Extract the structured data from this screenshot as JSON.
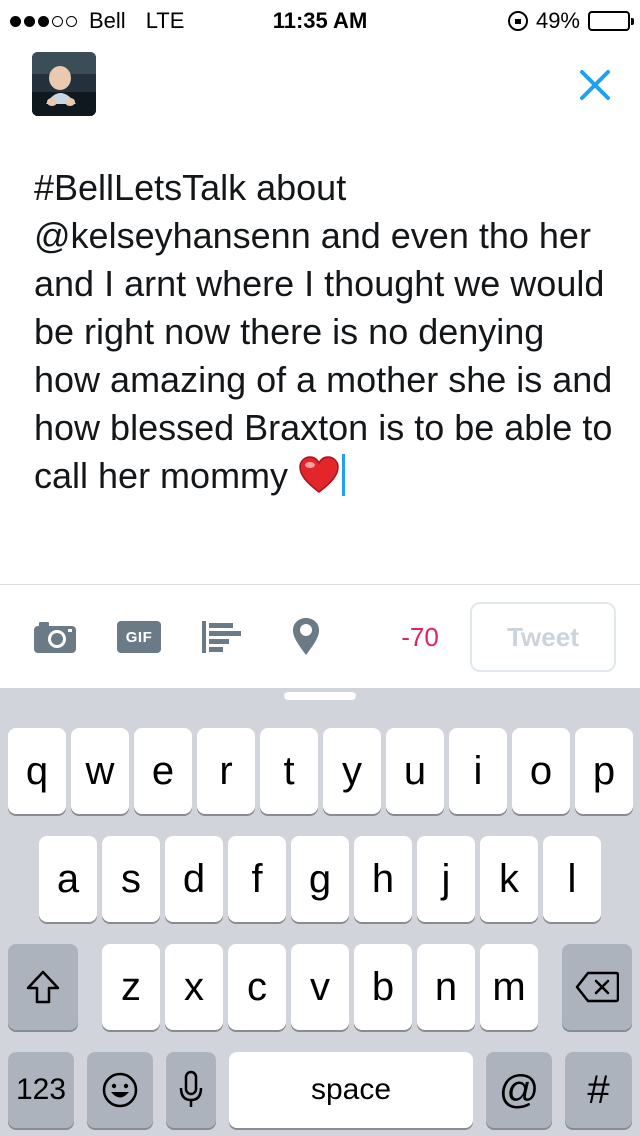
{
  "status_bar": {
    "carrier": "Bell",
    "network": "LTE",
    "time": "11:35 AM",
    "battery": "49%",
    "signal_bars": 3,
    "battery_level": 0.49
  },
  "compose": {
    "text": "#BellLetsTalk about @kelseyhansenn and even tho her and I arnt where I thought we would be right now there is no denying how amazing of a mother she is and how blessed Braxton is to be able to call her mommy"
  },
  "toolbar": {
    "char_count": "-70",
    "tweet_label": "Tweet",
    "gif_label": "GIF"
  },
  "keyboard": {
    "row1": [
      "q",
      "w",
      "e",
      "r",
      "t",
      "y",
      "u",
      "i",
      "o",
      "p"
    ],
    "row2": [
      "a",
      "s",
      "d",
      "f",
      "g",
      "h",
      "j",
      "k",
      "l"
    ],
    "row3": [
      "z",
      "x",
      "c",
      "v",
      "b",
      "n",
      "m"
    ],
    "numbers_label": "123",
    "space_label": "space",
    "at_label": "@",
    "hash_label": "#"
  },
  "colors": {
    "accent": "#1da1f2",
    "counter_negative": "#e0245e",
    "keyboard_bg": "#d1d5db",
    "key_dark": "#acb3bc"
  }
}
